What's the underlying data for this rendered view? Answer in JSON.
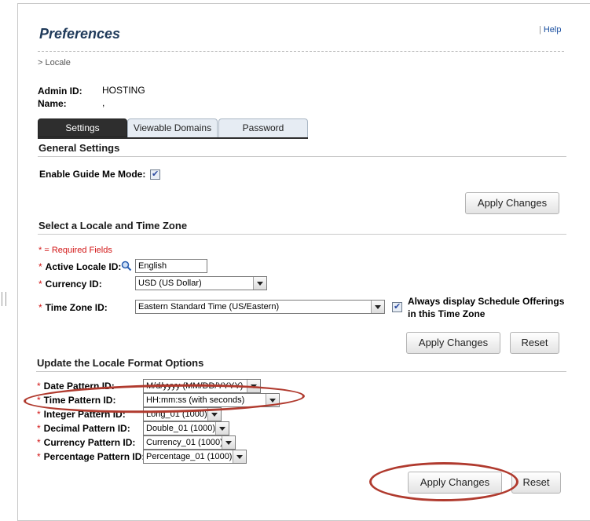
{
  "page": {
    "title": "Preferences",
    "help_link": "Help",
    "help_separator": "|",
    "breadcrumb": "> Locale"
  },
  "user": {
    "admin_id_label": "Admin ID:",
    "admin_id_value": "HOSTING",
    "name_label": "Name:",
    "name_value": ","
  },
  "tabs": [
    {
      "label": "Settings",
      "active": true
    },
    {
      "label": "Viewable Domains",
      "active": false
    },
    {
      "label": "Password",
      "active": false
    }
  ],
  "general_settings": {
    "heading": "General Settings",
    "guide_me_label": "Enable Guide Me Mode:",
    "guide_me_checked": true,
    "apply_label": "Apply Changes"
  },
  "locale_section": {
    "heading": "Select a Locale and Time Zone",
    "required_note": "* = Required Fields",
    "active_locale_label": "Active Locale ID:",
    "active_locale_value": "English",
    "currency_label": "Currency ID:",
    "currency_value": "USD (US Dollar)",
    "timezone_label": "Time Zone ID:",
    "timezone_value": "Eastern Standard Time (US/Eastern)",
    "always_display_line1": "Always display Schedule Offerings",
    "always_display_line2": "in this Time Zone",
    "always_display_checked": true,
    "apply_label": "Apply Changes",
    "reset_label": "Reset"
  },
  "format_section": {
    "heading": "Update the Locale Format Options",
    "date_label": "Date Pattern ID:",
    "date_value": "M/d/yyyy (MM/DD/YYYY)",
    "time_label": "Time Pattern ID:",
    "time_value": "HH:mm:ss (with seconds)",
    "integer_label": "Integer Pattern ID:",
    "integer_value": "Long_01 (1000)",
    "decimal_label": "Decimal Pattern ID:",
    "decimal_value": "Double_01 (1000)",
    "currency_label": "Currency Pattern ID:",
    "currency_value": "Currency_01 (1000)",
    "percentage_label": "Percentage Pattern ID:",
    "percentage_value": "Percentage_01 (1000)",
    "apply_label": "Apply Changes",
    "reset_label": "Reset"
  },
  "colors": {
    "title": "#1f3a5a",
    "required": "#d21414",
    "annotation": "#b03a2e",
    "active_tab": "#2e2e2e"
  }
}
